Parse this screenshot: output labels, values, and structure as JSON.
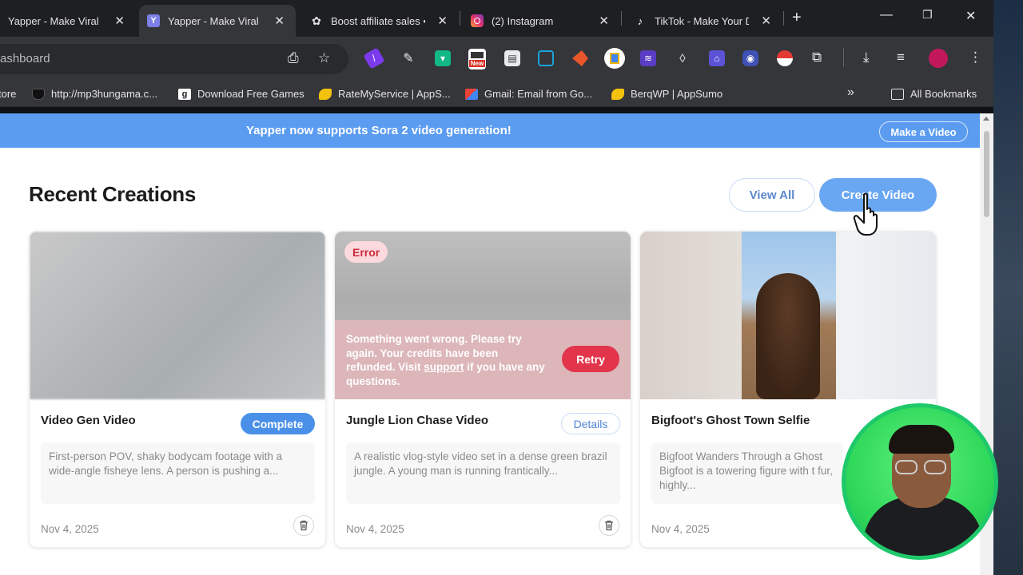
{
  "browser": {
    "tabs": [
      {
        "title": "Yapper - Make Viral",
        "favicon_color": "#7b7fe6"
      },
      {
        "title": "Yapper - Make Viral",
        "favicon_color": "#7b7fe6"
      },
      {
        "title": "Boost affiliate sales •",
        "favicon_color": "#e3e3e3"
      },
      {
        "title": "(2) Instagram",
        "favicon_color": "#e1306c"
      },
      {
        "title": "TikTok - Make Your D",
        "favicon_color": "#e3e3e3"
      }
    ],
    "address_text": "ashboard",
    "bookmarks": [
      {
        "label": "tore",
        "favicon_color": "#35363a"
      },
      {
        "label": "http://mp3hungama.c...",
        "favicon_color": "#202124"
      },
      {
        "label": "Download Free Games",
        "favicon_color": "#ffffff"
      },
      {
        "label": "RateMyService | AppS...",
        "favicon_color": "#f4c20d"
      },
      {
        "label": "Gmail: Email from Go...",
        "favicon_color": "#ea4335"
      },
      {
        "label": "BerqWP | AppSumo",
        "favicon_color": "#f4c20d"
      }
    ],
    "bookmarks_overflow": "»",
    "all_bookmarks": "All Bookmarks",
    "ext_new_badge": "New"
  },
  "banner": {
    "text": "Yapper now supports Sora 2 video generation!",
    "button": "Make a Video"
  },
  "header": {
    "title": "Recent Creations",
    "view_all": "View All",
    "create_video": "Create Video"
  },
  "cards": [
    {
      "name": "Video Gen Video",
      "status": "Complete",
      "description": "First-person POV, shaky bodycam footage with a wide-angle fisheye lens. A person is pushing a...",
      "date": "Nov 4, 2025"
    },
    {
      "name": "Jungle Lion Chase Video",
      "status": "Details",
      "error_badge": "Error",
      "error_before": "Something went wrong. Please try again. Your credits have been refunded. Visit ",
      "error_link": "support",
      "error_after": " if you have any questions.",
      "retry": "Retry",
      "description": "A realistic vlog-style video set in a dense green brazil jungle. A young man is running frantically...",
      "date": "Nov 4, 2025"
    },
    {
      "name": "Bigfoot's Ghost Town Selfie",
      "description": "Bigfoot Wanders Through a Ghost Bigfoot is a towering figure with t fur, highly...",
      "date": "Nov 4, 2025"
    }
  ],
  "colors": {
    "accent": "#5b9cf0",
    "complete": "#3d8de8",
    "error": "#e2344b"
  }
}
